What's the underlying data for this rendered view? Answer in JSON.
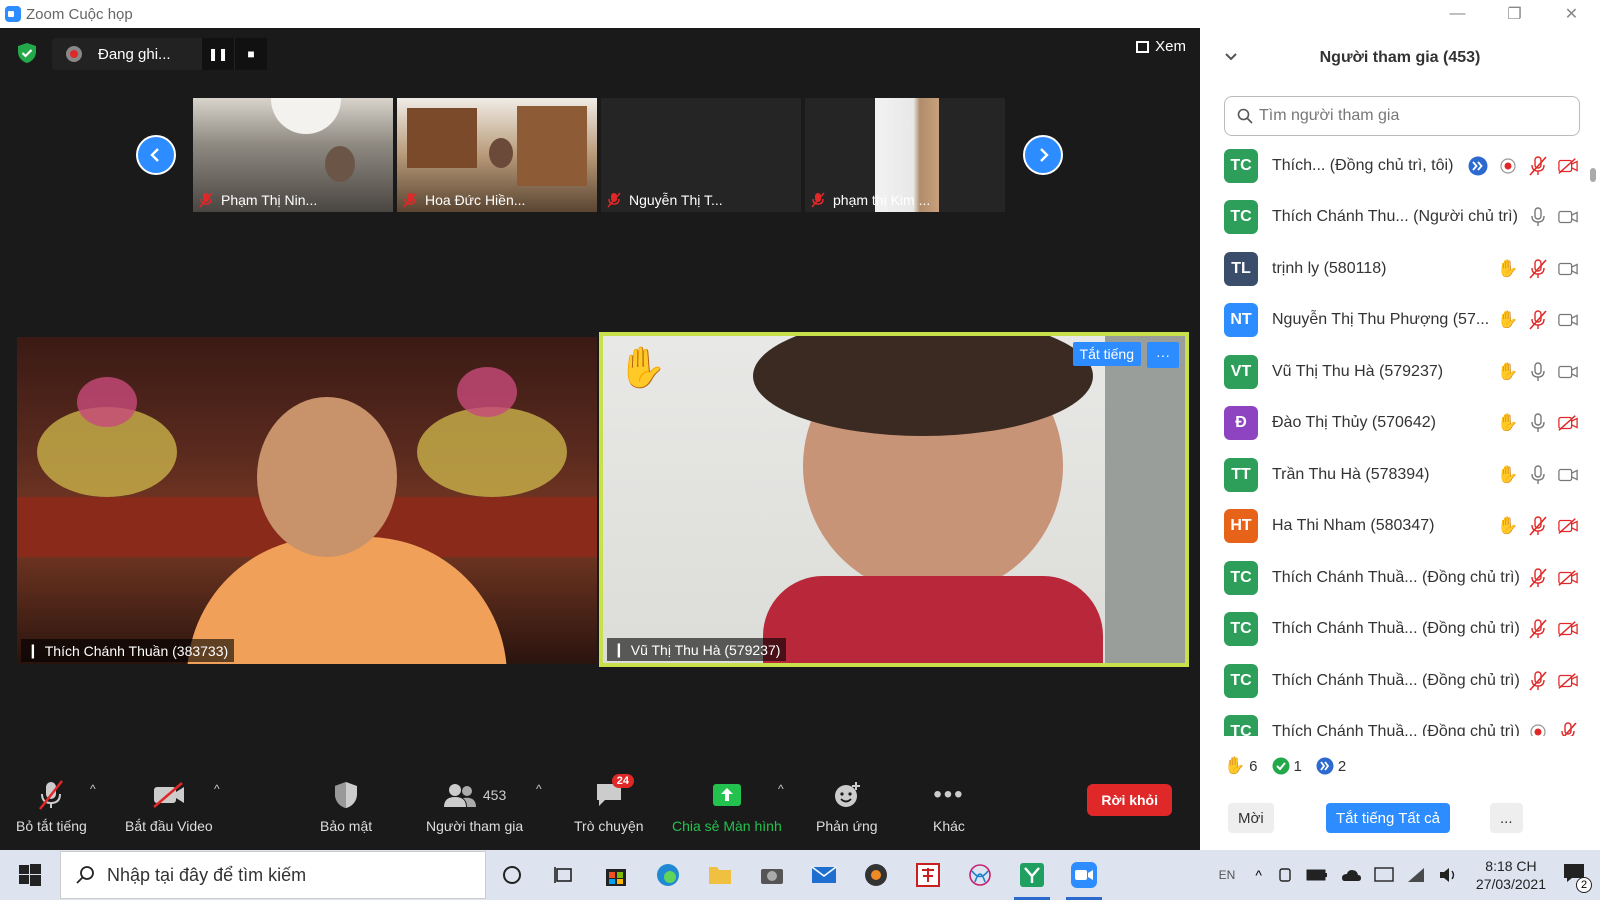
{
  "window": {
    "title": "Zoom Cuộc họp"
  },
  "recording": {
    "label": "Đang ghi..."
  },
  "view": {
    "label": "Xem"
  },
  "strip": [
    {
      "name": "Phạm Thị Nin..."
    },
    {
      "name": "Hoa Đức Hiền..."
    },
    {
      "name": "Nguyễn Thị T..."
    },
    {
      "name": "phạm thị Kim ..."
    }
  ],
  "tiles": {
    "left": {
      "name": "Thích Chánh Thuần (383733)"
    },
    "right": {
      "name": "Vũ Thị Thu Hà  (579237)",
      "mute_label": "Tắt tiếng",
      "more_label": "···"
    }
  },
  "toolbar": {
    "mute": "Bỏ tắt tiếng",
    "video": "Bắt đầu Video",
    "security": "Bảo mật",
    "participants": "Người tham gia",
    "participants_count": "453",
    "chat": "Trò chuyện",
    "chat_badge": "24",
    "share": "Chia sẻ Màn hình",
    "reactions": "Phản ứng",
    "more": "Khác",
    "leave": "Rời khỏi"
  },
  "panel": {
    "title": "Người tham gia (453)",
    "search_placeholder": "Tìm người tham gia",
    "participants": [
      {
        "initials": "TC",
        "color": "#2e9e5b",
        "name": "Thích...  (Đồng chủ trì, tôi)",
        "icons": [
          "fwd",
          "rec",
          "mic-off",
          "cam-off"
        ]
      },
      {
        "initials": "TC",
        "color": "#2e9e5b",
        "name": "Thích Chánh Thu...  (Người chủ trì)",
        "icons": [
          "mic",
          "cam"
        ]
      },
      {
        "initials": "TL",
        "color": "#3a4e6b",
        "name": "trịnh ly (580118)",
        "icons": [
          "hand",
          "mic-off",
          "cam"
        ]
      },
      {
        "initials": "NT",
        "color": "#2d8cff",
        "name": "Nguyễn Thị Thu Phượng (57...",
        "icons": [
          "hand",
          "mic-off",
          "cam"
        ]
      },
      {
        "initials": "VT",
        "color": "#2e9e5b",
        "name": "Vũ Thị Thu Hà  (579237)",
        "icons": [
          "hand",
          "mic",
          "cam"
        ]
      },
      {
        "initials": "Đ",
        "color": "#8e44c0",
        "name": "Đào Thị Thủy (570642)",
        "icons": [
          "hand",
          "mic",
          "cam-off"
        ]
      },
      {
        "initials": "TT",
        "color": "#2e9e5b",
        "name": "Trần Thu Hà (578394)",
        "icons": [
          "hand",
          "mic",
          "cam"
        ]
      },
      {
        "initials": "HT",
        "color": "#e8631a",
        "name": "Ha Thi Nham (580347)",
        "icons": [
          "hand",
          "mic-off",
          "cam-off"
        ]
      },
      {
        "initials": "TC",
        "color": "#2e9e5b",
        "name": "Thích Chánh Thuầ...  (Đồng chủ trì)",
        "icons": [
          "mic-off",
          "cam-off"
        ]
      },
      {
        "initials": "TC",
        "color": "#2e9e5b",
        "name": "Thích Chánh Thuầ...  (Đồng chủ trì)",
        "icons": [
          "mic-off",
          "cam-off"
        ]
      },
      {
        "initials": "TC",
        "color": "#2e9e5b",
        "name": "Thích Chánh Thuầ...  (Đồng chủ trì)",
        "icons": [
          "mic-off",
          "cam-off"
        ]
      },
      {
        "initials": "TC",
        "color": "#2e9e5b",
        "name": "Thích Chánh Thuầ...  (Đồng chủ trì)",
        "icons": [
          "rec",
          "mic-off"
        ]
      }
    ],
    "stats": {
      "hands": "6",
      "yes": "1",
      "faster": "2"
    },
    "invite": "Mời",
    "mute_all": "Tắt tiếng Tất cả",
    "more": "..."
  },
  "taskbar": {
    "search_placeholder": "Nhập tại đây để tìm kiếm",
    "lang": "EN",
    "time": "8:18 CH",
    "date": "27/03/2021",
    "notif_count": "2"
  },
  "colors": {
    "accent": "#2d8cff",
    "danger": "#e02828",
    "active_border": "#c8e04a"
  }
}
